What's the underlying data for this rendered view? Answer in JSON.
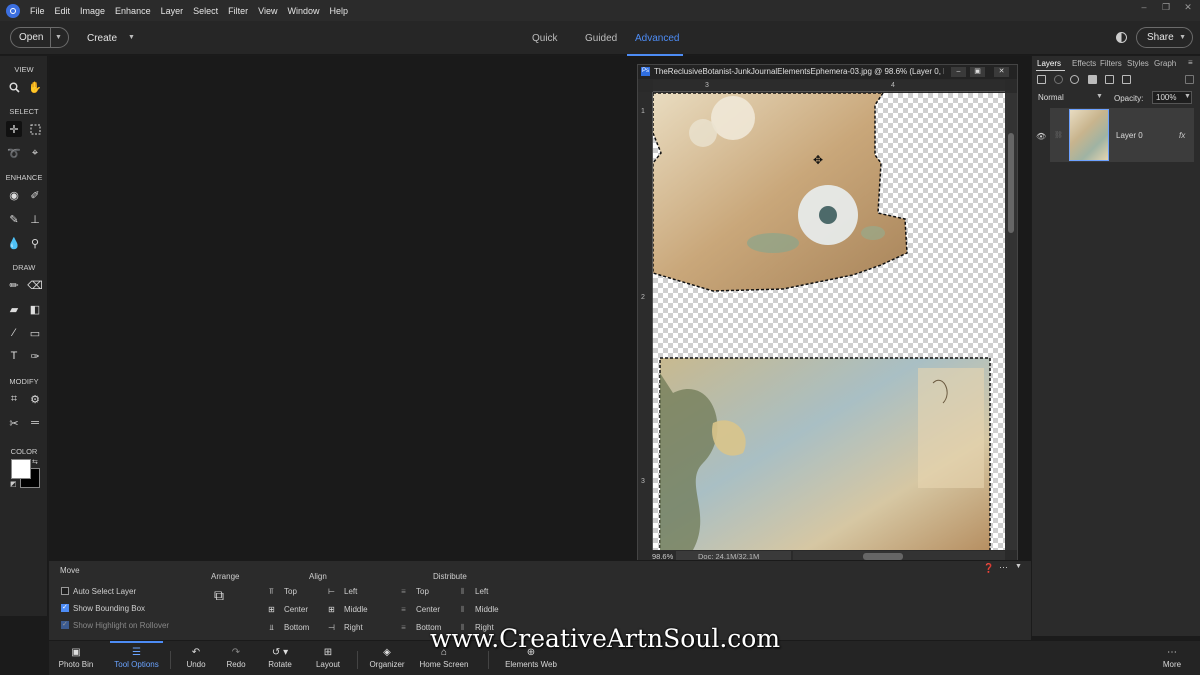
{
  "menubar": {
    "items": [
      "File",
      "Edit",
      "Image",
      "Enhance",
      "Layer",
      "Select",
      "Filter",
      "View",
      "Window",
      "Help"
    ]
  },
  "topbar": {
    "open_label": "Open",
    "create_label": "Create",
    "modes": [
      "Quick",
      "Guided",
      "Advanced"
    ],
    "active_mode": "Advanced",
    "share_label": "Share"
  },
  "toolbox": {
    "sections": [
      "VIEW",
      "SELECT",
      "ENHANCE",
      "DRAW",
      "MODIFY",
      "COLOR"
    ],
    "foreground_color": "#ffffff",
    "background_color": "#000000"
  },
  "document": {
    "title": "TheReclusiveBotanist-JunkJournalElementsEphemera-03.jpg @ 98.6% (Layer 0, R...",
    "ruler_top": [
      "3",
      "4"
    ],
    "ruler_left": [
      "1",
      "2",
      "3"
    ],
    "zoom": "98.6%",
    "doc_size": "Doc: 24.1M/32.1M"
  },
  "panel": {
    "tabs": [
      "Layers",
      "Effects",
      "Filters",
      "Styles",
      "Graph"
    ],
    "blend_mode": "Normal",
    "opacity_label": "Opacity:",
    "opacity_value": "100%",
    "layer_name": "Layer 0",
    "fx": "fx"
  },
  "tool_options": {
    "tool_name": "Move",
    "auto_select": "Auto Select Layer",
    "bounding_box": "Show Bounding Box",
    "highlight": "Show Highlight on Rollover",
    "arrange_label": "Arrange",
    "align_label": "Align",
    "align_left_col": [
      "Top",
      "Center",
      "Bottom"
    ],
    "align_right_col": [
      "Left",
      "Middle",
      "Right"
    ],
    "distribute_label": "Distribute",
    "dist_left_col": [
      "Top",
      "Center",
      "Bottom"
    ],
    "dist_right_col": [
      "Left",
      "Middle",
      "Right"
    ]
  },
  "taskbar": {
    "photo_bin": "Photo Bin",
    "tool_options": "Tool Options",
    "undo": "Undo",
    "redo": "Redo",
    "rotate": "Rotate",
    "layout": "Layout",
    "organizer": "Organizer",
    "home_screen": "Home Screen",
    "elements_web": "Elements Web",
    "more": "More"
  },
  "watermark": "www.CreativeArtnSoul.com",
  "colors": {
    "accent": "#4d8cf5"
  }
}
